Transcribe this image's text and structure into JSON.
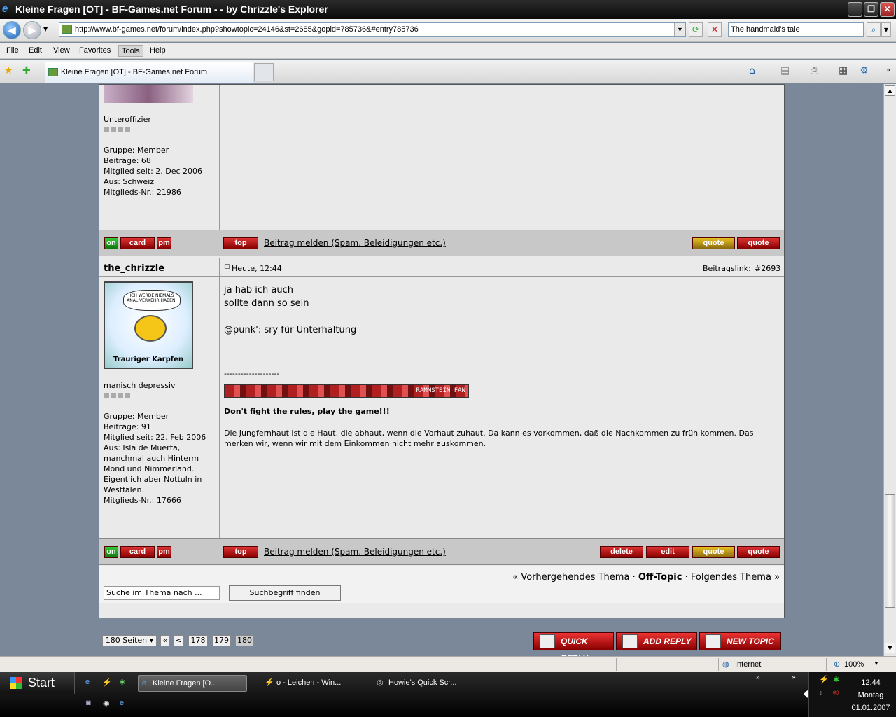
{
  "window": {
    "title": "Kleine Fragen [OT] - BF-Games.net Forum -  - by Chrizzle's Explorer",
    "min": "_",
    "max": "❐",
    "close": "✕"
  },
  "address": {
    "url": "http://www.bf-games.net/forum/index.php?showtopic=24146&st=2685&gopid=785736&#entry785736",
    "search_value": "The handmaid's tale"
  },
  "menu": [
    "File",
    "Edit",
    "View",
    "Favorites",
    "Tools",
    "Help"
  ],
  "tab": {
    "title": "Kleine Fragen [OT] - BF-Games.net Forum"
  },
  "post1": {
    "rank": "Unteroffizier",
    "group": "Gruppe: Member",
    "posts": "Beiträge: 68",
    "joined": "Mitglied seit: 2. Dec 2006",
    "from": "Aus: Schweiz",
    "member_no": "Mitglieds-Nr.: 21986"
  },
  "buttons": {
    "on": "on",
    "card": "card",
    "pm": "pm",
    "top": "top",
    "report": "Beitrag melden (Spam, Beleidigungen etc.)",
    "add_quote": "quote",
    "quote": "quote",
    "delete": "delete",
    "edit": "edit"
  },
  "post2": {
    "author": "the_chrizzle",
    "time": "Heute, 12:44",
    "permalink_label": "Beitragslink:",
    "permalink": "#2693",
    "avatar_bubble": "ICH WERDE NIEMALS ANAL VERKEHR HABEN!",
    "avatar_caption": "Trauriger Karpfen",
    "rank": "manisch depressiv",
    "group": "Gruppe: Member",
    "posts": "Beiträge: 91",
    "joined": "Mitglied seit: 22. Feb 2006",
    "from_lines": [
      "Aus: Isla de Muerta,",
      "manchmal auch Hinterm",
      "Mond und Nimmerland.",
      "Eigentlich aber Nottuln in",
      "Westfalen."
    ],
    "member_no": "Mitglieds-Nr.: 17666",
    "body": [
      "ja hab ich auch",
      "sollte dann so sein",
      "@punk': sry für Unterhaltung"
    ],
    "sig_sep": "--------------------",
    "banner_text": "RAMMSTEIN FAN",
    "sig_bold": "Don't fight the rules, play the game!!!",
    "sig_text": [
      "Die Jungfernhaut ist die Haut, die abhaut, wenn die Vorhaut zuhaut. Da kann es vorkommen, daß die Nachkommen zu früh kommen. Das",
      "merken wir, wenn wir mit dem Einkommen nicht mehr auskommen."
    ]
  },
  "topic_nav": {
    "prev": "« Vorhergehendes Thema",
    "sep": "·",
    "current": "Off-Topic",
    "next": "Folgendes Thema »"
  },
  "search": {
    "placeholder": "Suche im Thema nach ...",
    "button": "Suchbegriff finden"
  },
  "pager": {
    "pages": "180 Seiten",
    "first": "«",
    "prev": "<",
    "p1": "178",
    "p2": "179",
    "p3": "180"
  },
  "actions": {
    "quick_reply": "QUICK REPLY",
    "add_reply": "ADD REPLY",
    "new_topic": "NEW TOPIC"
  },
  "status": {
    "zone": "Internet",
    "zoom": "100%"
  },
  "taskbar": {
    "start": "Start",
    "items": [
      "Kleine Fragen [O...",
      "o - Leichen - Win...",
      "Howie's Quick Scr..."
    ],
    "time": "12:44",
    "day": "Montag",
    "date": "01.01.2007"
  },
  "colors": {
    "accent_red": "#b01818",
    "forum_bg": "#eaeaea",
    "bar_gray": "#c8c8c8"
  }
}
